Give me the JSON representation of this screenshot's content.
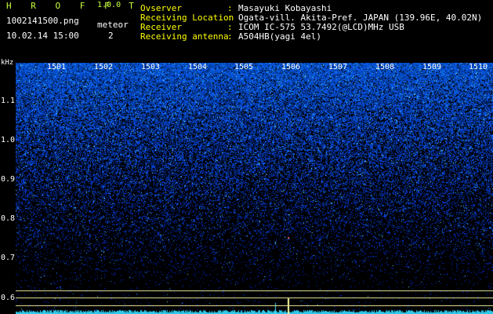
{
  "header": {
    "app_title": "H R O F F T",
    "app_version": "1.0.0",
    "file_name": "1002141500.png",
    "datetime": "10.02.14 15:00",
    "meteor_label": "meteor",
    "meteor_count": "2"
  },
  "info": [
    {
      "key": "Ovserver",
      "value": "Masayuki Kobayashi"
    },
    {
      "key": "Receiving Location",
      "value": "Ogata-vill. Akita-Pref. JAPAN (139.96E, 40.02N)"
    },
    {
      "key": "Receiver",
      "value": "ICOM IC-575 53.7492(@LCD)MHz USB"
    },
    {
      "key": "Receiving antenna",
      "value": "A504HB(yagi 4el)"
    }
  ],
  "separator": ":",
  "plot": {
    "unit": "kHz",
    "y_ticks": [
      "1.1",
      "1.0",
      "0.9",
      "0.8",
      "0.7",
      "0.6"
    ],
    "x_ticks": [
      "1501",
      "1502",
      "1503",
      "1504",
      "1505",
      "1506",
      "1507",
      "1508",
      "1509",
      "1510"
    ],
    "colors": {
      "background": "#000000",
      "noise_low": "#0a1a8c",
      "noise_high": "#2050ff",
      "speck": "#40e0ff",
      "baseline": "#30c8e8",
      "ref_line": "#d8d890",
      "header_text": "#c8ff3c",
      "info_text": "#ffffff"
    }
  }
}
